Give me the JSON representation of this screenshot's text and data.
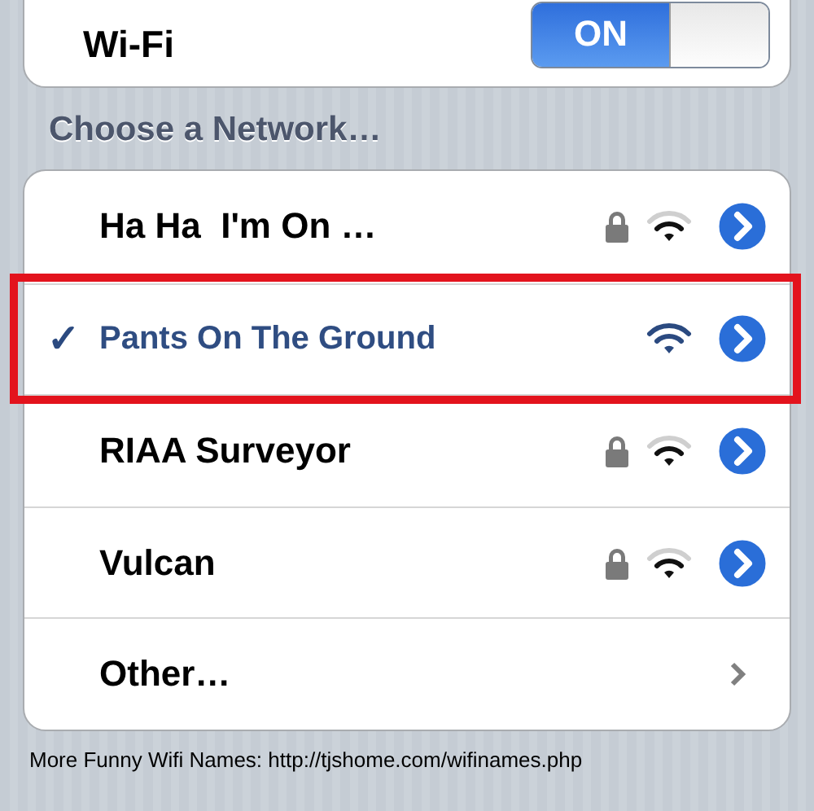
{
  "wifi": {
    "label": "Wi-Fi",
    "on": true,
    "on_label": "ON"
  },
  "section_header": "Choose a Network…",
  "networks": [
    {
      "kind": "network",
      "name": "Ha Ha  I'm On …",
      "selected": false,
      "locked": true,
      "highlighted": false
    },
    {
      "kind": "network",
      "name": "Pants On The Ground",
      "selected": true,
      "checkmark": "✓",
      "locked": false,
      "highlighted": true
    },
    {
      "kind": "network",
      "name": "RIAA Surveyor",
      "selected": false,
      "locked": true,
      "highlighted": false
    },
    {
      "kind": "network",
      "name": "Vulcan",
      "selected": false,
      "locked": true,
      "highlighted": false
    },
    {
      "kind": "other",
      "name": "Other…",
      "selected": false,
      "highlighted": false
    }
  ],
  "caption": "More Funny Wifi Names: http://tjshome.com/wifinames.php"
}
